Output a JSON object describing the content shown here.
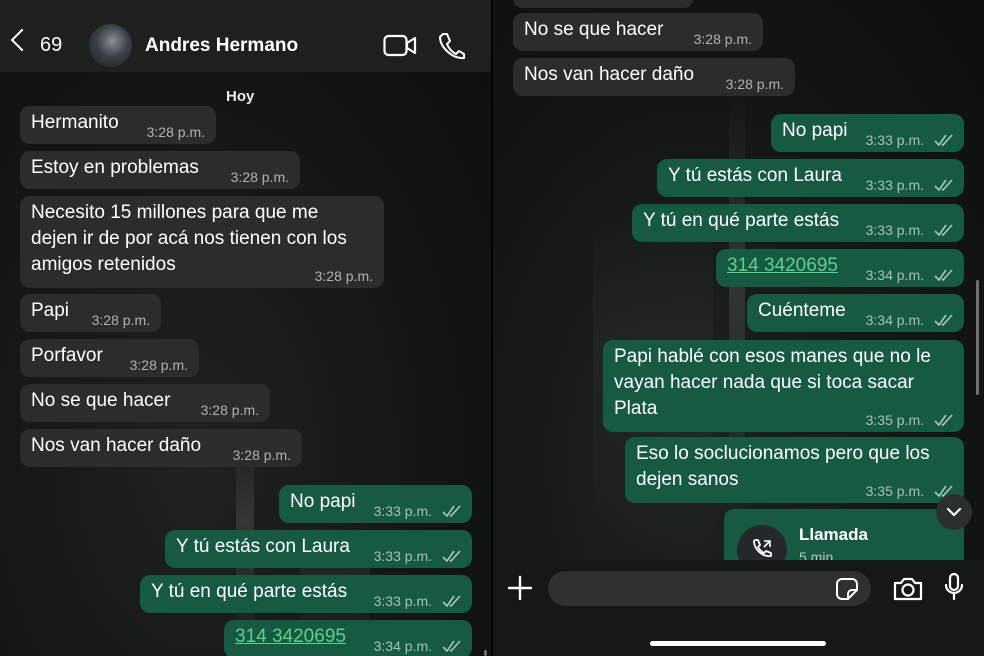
{
  "left": {
    "header": {
      "back_count": "69",
      "contact_name": "Andres Hermano"
    },
    "day_label": "Hoy",
    "messages": [
      {
        "text": "Hermanito",
        "time": "3:28 p.m."
      },
      {
        "text": "Estoy en problemas",
        "time": "3:28 p.m."
      },
      {
        "text": "Necesito 15 millones para que me dejen ir de por acá nos tienen con los amigos retenidos",
        "time": "3:28 p.m."
      },
      {
        "text": "Papi",
        "time": "3:28 p.m."
      },
      {
        "text": "Porfavor",
        "time": "3:28 p.m."
      },
      {
        "text": "No se que hacer",
        "time": "3:28 p.m."
      },
      {
        "text": "Nos van hacer daño",
        "time": "3:28 p.m."
      },
      {
        "text": "No papi",
        "time": "3:33 p.m."
      },
      {
        "text": "Y tú estás con Laura",
        "time": "3:33 p.m."
      },
      {
        "text": "Y tú en qué parte estás",
        "time": "3:33 p.m."
      },
      {
        "text": "314 3420695",
        "time": "3:34 p.m."
      }
    ]
  },
  "right": {
    "messages": [
      {
        "text": "No se que hacer",
        "time": "3:28 p.m."
      },
      {
        "text": "Nos van hacer daño",
        "time": "3:28 p.m."
      },
      {
        "text": "No papi",
        "time": "3:33 p.m."
      },
      {
        "text": "Y tú estás con Laura",
        "time": "3:33 p.m."
      },
      {
        "text": "Y tú en qué parte estás",
        "time": "3:33 p.m."
      },
      {
        "text": "314 3420695",
        "time": "3:34 p.m."
      },
      {
        "text": "Cuénteme",
        "time": "3:34 p.m."
      },
      {
        "text": "Papi hablé con esos manes que no le vayan hacer nada que si toca sacar Plata",
        "time": "3:35 p.m."
      },
      {
        "text": "Eso lo soclucionamos pero que los dejen sanos",
        "time": "3:35 p.m."
      }
    ],
    "call": {
      "title": "Llamada",
      "subtitle": "5 min"
    }
  },
  "colors": {
    "incoming_bubble": "#2a2d2b",
    "outgoing_bubble": "#165a42",
    "link": "#5fd08f"
  },
  "icons": [
    "chevron-left-icon",
    "video-call-icon",
    "phone-icon",
    "double-check-icon",
    "plus-icon",
    "sticker-icon",
    "camera-icon",
    "microphone-icon",
    "chevron-down-icon",
    "call-icon"
  ]
}
